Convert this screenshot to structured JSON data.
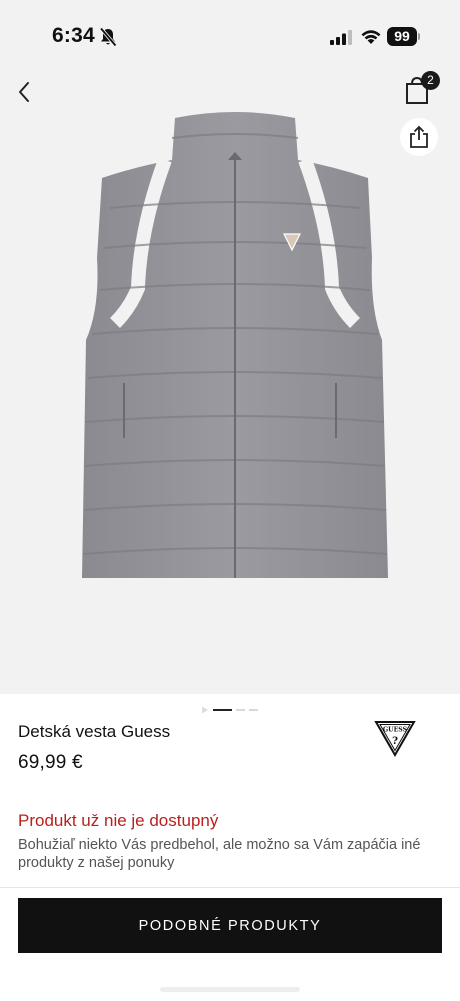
{
  "status_bar": {
    "time": "6:34",
    "battery": "99",
    "icons": [
      "bell-slash-icon",
      "signal-icon",
      "wifi-icon",
      "battery-icon"
    ]
  },
  "header": {
    "back_icon": "chevron-left-icon",
    "bag_icon": "shopping-bag-icon",
    "bag_count": "2",
    "share_icon": "share-icon"
  },
  "gallery": {
    "image": "gray-quilted-vest",
    "pages": 4,
    "current_page": 1
  },
  "product": {
    "title": "Detská vesta Guess",
    "price": "69,99 €",
    "brand_logo_text": "GUESS"
  },
  "availability": {
    "title": "Produkt už nie je dostupný",
    "message": "Bohužiaľ niekto Vás predbehol, ale možno sa Vám zapáčia iné produkty z našej ponuky"
  },
  "action": {
    "similar_label": "PODOBNÉ PRODUKTY"
  },
  "colors": {
    "accent_red": "#b81f1f",
    "button_black": "#111111",
    "hero_background": "#f2f2f2"
  }
}
